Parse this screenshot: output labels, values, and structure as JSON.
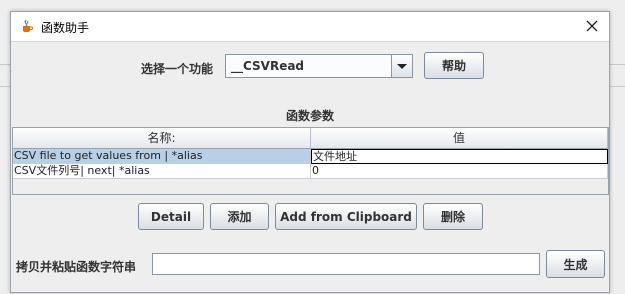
{
  "window": {
    "title": "函数助手"
  },
  "function": {
    "label": "选择一个功能",
    "selected": "__CSVRead"
  },
  "buttons": {
    "help": "帮助",
    "detail": "Detail",
    "add": "添加",
    "add_clipboard": "Add from Clipboard",
    "delete": "删除",
    "generate": "生成"
  },
  "params": {
    "title": "函数参数",
    "headers": [
      "名称:",
      "值"
    ],
    "rows": [
      {
        "name": "CSV file to get values from | *alias",
        "value": "文件地址"
      },
      {
        "name": "CSV文件列号| next| *alias",
        "value": "0"
      }
    ]
  },
  "paste": {
    "label": "拷贝并粘贴函数字符串",
    "value": ""
  },
  "colors": {
    "selected_row": "#b8cfe5",
    "window_bg": "#eeeeee"
  },
  "icons": {
    "app": "java-cup-icon",
    "close": "close-icon",
    "dropdown": "chevron-down-icon"
  }
}
